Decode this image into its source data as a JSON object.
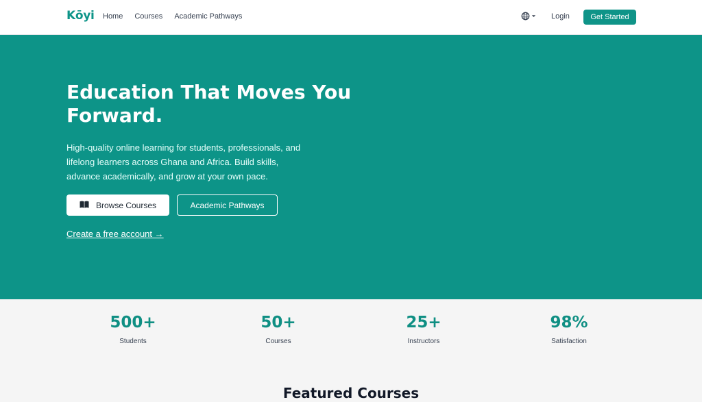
{
  "brand": {
    "name": "Kōyi",
    "accent": "#0d9488"
  },
  "nav": {
    "links": [
      "Home",
      "Courses",
      "Academic Pathways"
    ],
    "language_icon": "globe-icon",
    "login": "Login",
    "cta": "Get Started"
  },
  "hero": {
    "title": "Education That Moves You Forward.",
    "subtitle": "High-quality online learning for students, professionals, and lifelong learners across Ghana and Africa. Build skills, advance academically, and grow at your own pace.",
    "primary_button": "Browse Courses",
    "primary_button_icon": "book-icon",
    "secondary_button": "Academic Pathways",
    "link": "Create a free account →"
  },
  "stats": [
    {
      "value": "500+",
      "label": "Students"
    },
    {
      "value": "50+",
      "label": "Courses"
    },
    {
      "value": "25+",
      "label": "Instructors"
    },
    {
      "value": "98%",
      "label": "Satisfaction"
    }
  ],
  "featured": {
    "heading": "Featured Courses"
  }
}
